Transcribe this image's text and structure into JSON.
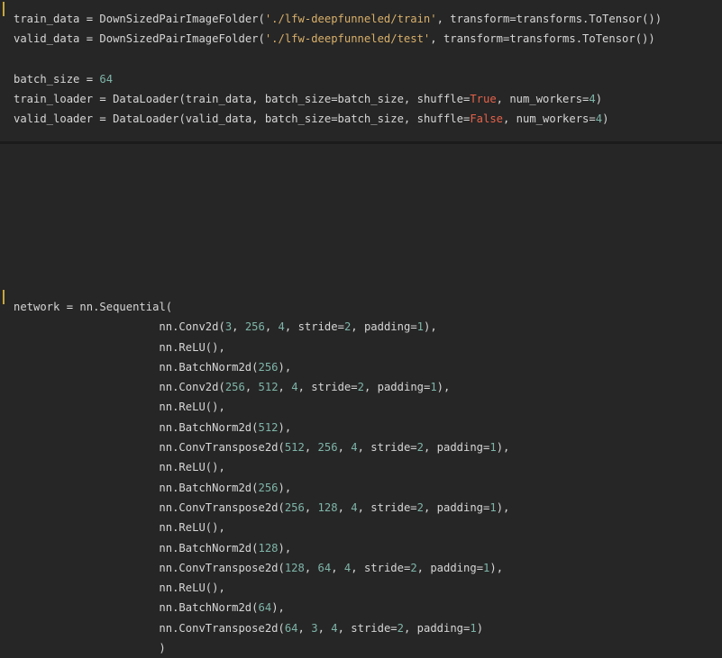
{
  "cells": [
    {
      "lines": [
        [
          [
            "ident",
            "train_data"
          ],
          [
            "op",
            " = "
          ],
          [
            "ident",
            "DownSizedPairImageFolder("
          ],
          [
            "str",
            "'./lfw-deepfunneled/train'"
          ],
          [
            "ident",
            ", transform=transforms.ToTensor())"
          ]
        ],
        [
          [
            "ident",
            "valid_data"
          ],
          [
            "op",
            " = "
          ],
          [
            "ident",
            "DownSizedPairImageFolder("
          ],
          [
            "str",
            "'./lfw-deepfunneled/test'"
          ],
          [
            "ident",
            ", transform=transforms.ToTensor())"
          ]
        ],
        [],
        [
          [
            "ident",
            "batch_size"
          ],
          [
            "op",
            " = "
          ],
          [
            "num",
            "64"
          ]
        ],
        [
          [
            "ident",
            "train_loader"
          ],
          [
            "op",
            " = "
          ],
          [
            "ident",
            "DataLoader(train_data, batch_size=batch_size, shuffle="
          ],
          [
            "kw",
            "True"
          ],
          [
            "ident",
            ", num_workers="
          ],
          [
            "num",
            "4"
          ],
          [
            "ident",
            ")"
          ]
        ],
        [
          [
            "ident",
            "valid_loader"
          ],
          [
            "op",
            " = "
          ],
          [
            "ident",
            "DataLoader(valid_data, batch_size=batch_size, shuffle="
          ],
          [
            "kw",
            "False"
          ],
          [
            "ident",
            ", num_workers="
          ],
          [
            "num",
            "4"
          ],
          [
            "ident",
            ")"
          ]
        ]
      ]
    },
    {
      "lines": [
        [
          [
            "ident",
            "network"
          ],
          [
            "op",
            " = "
          ],
          [
            "ident",
            "nn.Sequential("
          ]
        ],
        [
          [
            "ident",
            "                      nn.Conv2d("
          ],
          [
            "num",
            "3"
          ],
          [
            "ident",
            ", "
          ],
          [
            "num",
            "256"
          ],
          [
            "ident",
            ", "
          ],
          [
            "num",
            "4"
          ],
          [
            "ident",
            ", stride="
          ],
          [
            "num",
            "2"
          ],
          [
            "ident",
            ", padding="
          ],
          [
            "num",
            "1"
          ],
          [
            "ident",
            "),"
          ]
        ],
        [
          [
            "ident",
            "                      nn.ReLU(),"
          ]
        ],
        [
          [
            "ident",
            "                      nn.BatchNorm2d("
          ],
          [
            "num",
            "256"
          ],
          [
            "ident",
            "),"
          ]
        ],
        [
          [
            "ident",
            "                      nn.Conv2d("
          ],
          [
            "num",
            "256"
          ],
          [
            "ident",
            ", "
          ],
          [
            "num",
            "512"
          ],
          [
            "ident",
            ", "
          ],
          [
            "num",
            "4"
          ],
          [
            "ident",
            ", stride="
          ],
          [
            "num",
            "2"
          ],
          [
            "ident",
            ", padding="
          ],
          [
            "num",
            "1"
          ],
          [
            "ident",
            "),"
          ]
        ],
        [
          [
            "ident",
            "                      nn.ReLU(),"
          ]
        ],
        [
          [
            "ident",
            "                      nn.BatchNorm2d("
          ],
          [
            "num",
            "512"
          ],
          [
            "ident",
            "),"
          ]
        ],
        [
          [
            "ident",
            "                      nn.ConvTranspose2d("
          ],
          [
            "num",
            "512"
          ],
          [
            "ident",
            ", "
          ],
          [
            "num",
            "256"
          ],
          [
            "ident",
            ", "
          ],
          [
            "num",
            "4"
          ],
          [
            "ident",
            ", stride="
          ],
          [
            "num",
            "2"
          ],
          [
            "ident",
            ", padding="
          ],
          [
            "num",
            "1"
          ],
          [
            "ident",
            "),"
          ]
        ],
        [
          [
            "ident",
            "                      nn.ReLU(),"
          ]
        ],
        [
          [
            "ident",
            "                      nn.BatchNorm2d("
          ],
          [
            "num",
            "256"
          ],
          [
            "ident",
            "),"
          ]
        ],
        [
          [
            "ident",
            "                      nn.ConvTranspose2d("
          ],
          [
            "num",
            "256"
          ],
          [
            "ident",
            ", "
          ],
          [
            "num",
            "128"
          ],
          [
            "ident",
            ", "
          ],
          [
            "num",
            "4"
          ],
          [
            "ident",
            ", stride="
          ],
          [
            "num",
            "2"
          ],
          [
            "ident",
            ", padding="
          ],
          [
            "num",
            "1"
          ],
          [
            "ident",
            "),"
          ]
        ],
        [
          [
            "ident",
            "                      nn.ReLU(),"
          ]
        ],
        [
          [
            "ident",
            "                      nn.BatchNorm2d("
          ],
          [
            "num",
            "128"
          ],
          [
            "ident",
            "),"
          ]
        ],
        [
          [
            "ident",
            "                      nn.ConvTranspose2d("
          ],
          [
            "num",
            "128"
          ],
          [
            "ident",
            ", "
          ],
          [
            "num",
            "64"
          ],
          [
            "ident",
            ", "
          ],
          [
            "num",
            "4"
          ],
          [
            "ident",
            ", stride="
          ],
          [
            "num",
            "2"
          ],
          [
            "ident",
            ", padding="
          ],
          [
            "num",
            "1"
          ],
          [
            "ident",
            "),"
          ]
        ],
        [
          [
            "ident",
            "                      nn.ReLU(),"
          ]
        ],
        [
          [
            "ident",
            "                      nn.BatchNorm2d("
          ],
          [
            "num",
            "64"
          ],
          [
            "ident",
            "),"
          ]
        ],
        [
          [
            "ident",
            "                      nn.ConvTranspose2d("
          ],
          [
            "num",
            "64"
          ],
          [
            "ident",
            ", "
          ],
          [
            "num",
            "3"
          ],
          [
            "ident",
            ", "
          ],
          [
            "num",
            "4"
          ],
          [
            "ident",
            ", stride="
          ],
          [
            "num",
            "2"
          ],
          [
            "ident",
            ", padding="
          ],
          [
            "num",
            "1"
          ],
          [
            "ident",
            ")"
          ]
        ],
        [
          [
            "ident",
            "                      )"
          ]
        ]
      ]
    }
  ]
}
